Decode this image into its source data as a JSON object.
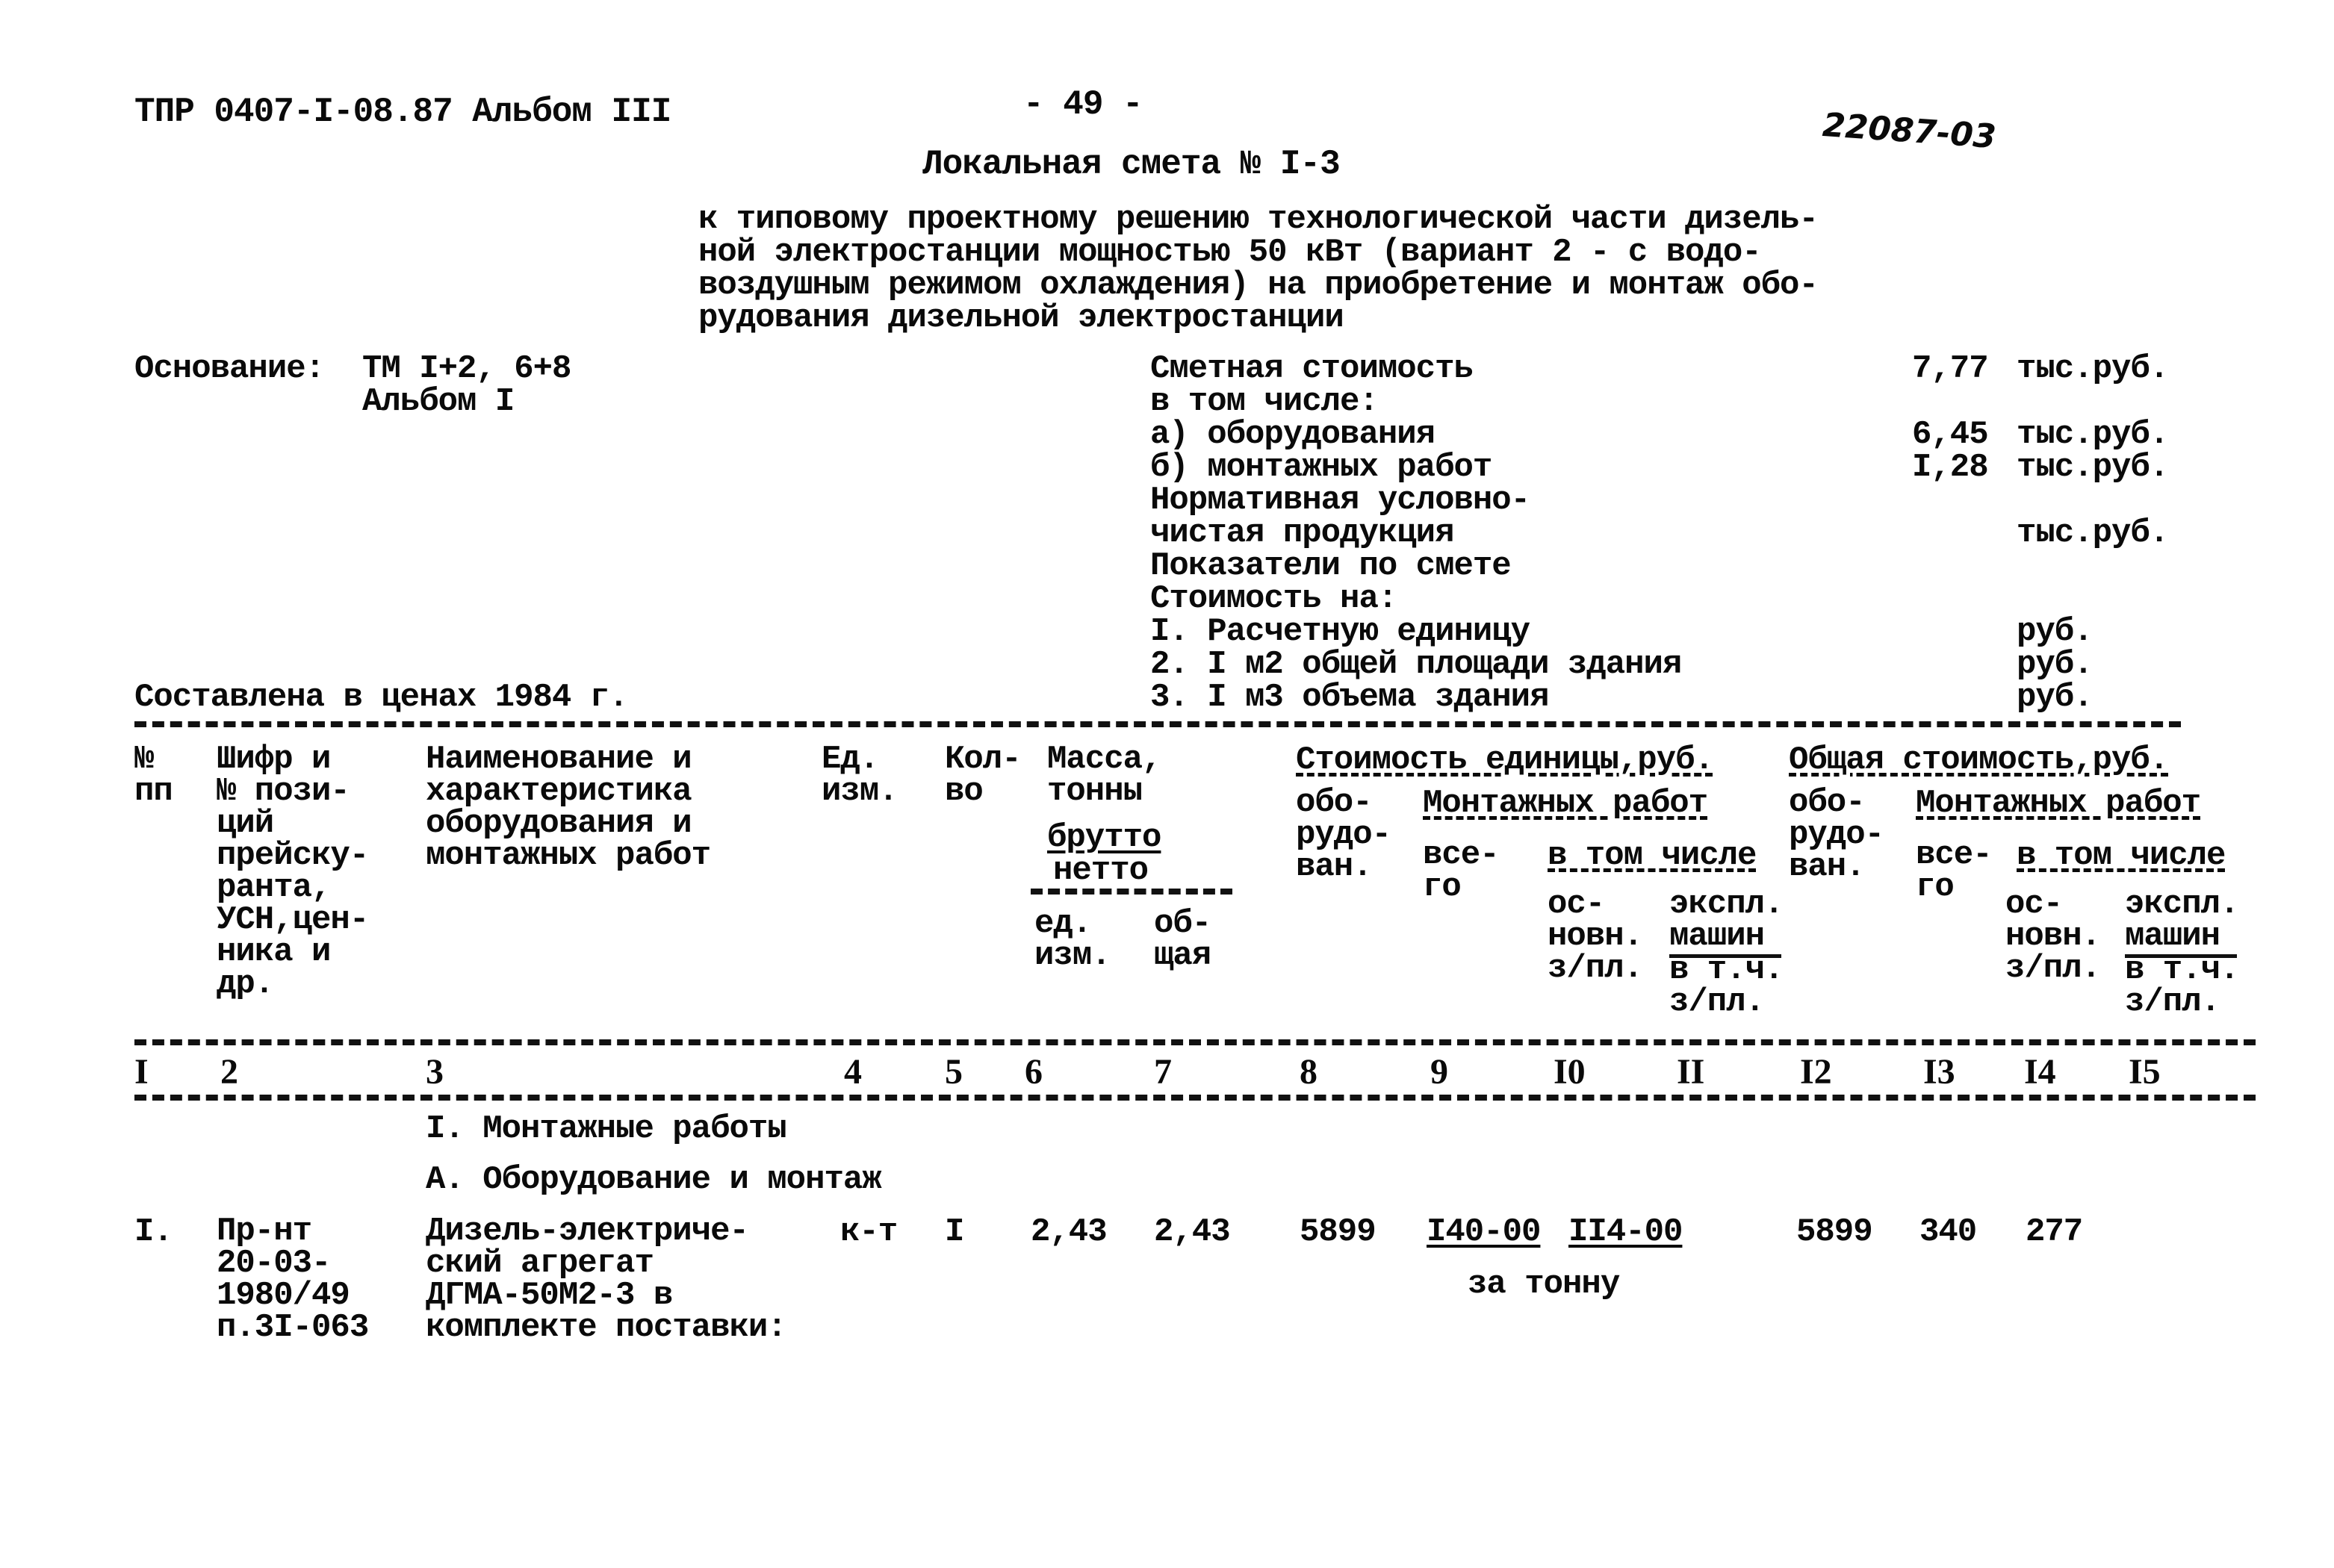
{
  "header": {
    "doc_code": "ТПР 0407-I-08.87 Альбом III",
    "page_number": "- 49 -",
    "stamp": "22087-03",
    "title": "Локальная смета № I-3",
    "subtitle_lines": [
      "к типовому проектному решению технологической части дизель-",
      "ной электростанции мощностью 50 кВт (вариант 2 - с водо-",
      "воздушным режимом охлаждения) на приобретение и монтаж обо-",
      "рудования дизельной электростанции"
    ]
  },
  "basis": {
    "label": "Основание:",
    "line1": "ТМ I+2, 6+8",
    "line2": "Альбом I"
  },
  "summary": {
    "rows": [
      {
        "label": "Сметная стоимость",
        "value": "7,77",
        "unit": "тыс.руб."
      },
      {
        "label": "в том числе:",
        "value": "",
        "unit": ""
      },
      {
        "label": "а) оборудования",
        "value": "6,45",
        "unit": "тыс.руб."
      },
      {
        "label": "б) монтажных работ",
        "value": "I,28",
        "unit": "тыс.руб."
      },
      {
        "label": "Нормативная условно-",
        "value": "",
        "unit": ""
      },
      {
        "label": "чистая продукция",
        "value": "",
        "unit": "тыс.руб."
      },
      {
        "label": "Показатели по смете",
        "value": "",
        "unit": ""
      },
      {
        "label": "Стоимость на:",
        "value": "",
        "unit": ""
      },
      {
        "label": "I. Расчетную единицу",
        "value": "",
        "unit": "руб."
      },
      {
        "label": "2. I м2 общей площади здания",
        "value": "",
        "unit": "руб."
      },
      {
        "label": "3. I м3 объема здания",
        "value": "",
        "unit": "руб."
      }
    ]
  },
  "prices_note": "Составлена в ценах 1984 г.",
  "table": {
    "headers": {
      "c1": [
        "№",
        "пп"
      ],
      "c2": [
        "Шифр и",
        "№ пози-",
        "ций",
        "прейску-",
        "ранта,",
        "УСН,цен-",
        "ника и",
        "др."
      ],
      "c3": [
        "Наименование и",
        "характеристика",
        "оборудования и",
        "монтажных работ"
      ],
      "c4": [
        "Ед.",
        "изм."
      ],
      "c5": [
        "Кол-",
        "во"
      ],
      "mass": [
        "Масса,",
        "тонны"
      ],
      "mass_frac_top": "брутто",
      "mass_frac_bottom": "нетто",
      "c6": [
        "ед.",
        "изм."
      ],
      "c7": [
        "об-",
        "щая"
      ],
      "unit_cost_group": "Стоимость единицы,руб.",
      "total_cost_group": "Общая стоимость,руб.",
      "equip": [
        "обо-",
        "рудо-",
        "ван."
      ],
      "mont_group": "Монтажных работ",
      "total_all": [
        "все-",
        "го"
      ],
      "incl": "в том числе",
      "basic_wage": [
        "ос-",
        "новн.",
        "з/пл."
      ],
      "machines": [
        "экспл.",
        "машин"
      ],
      "machines_sub": [
        "в т.ч.",
        "з/пл."
      ]
    },
    "column_numbers": [
      "I",
      "2",
      "3",
      "4",
      "5",
      "6",
      "7",
      "8",
      "9",
      "I0",
      "II",
      "I2",
      "I3",
      "I4",
      "I5"
    ],
    "section_title": "I. Монтажные работы",
    "subsection_title": "А. Оборудование и монтаж",
    "rows": [
      {
        "num": "I.",
        "code": [
          "Пр-нт",
          "20-03-",
          "1980/49",
          "п.3I-063"
        ],
        "name": [
          "Дизель-электриче-",
          "ский агрегат",
          "ДГМА-50М2-3 в",
          "комплекте поставки:"
        ],
        "unit": "к-т",
        "qty": "I",
        "mass_unit": "2,43",
        "mass_total": "2,43",
        "unit_equip": "5899",
        "unit_mont_total": "I40-00",
        "unit_mont_basic": "II4-00",
        "unit_mont_note": "за тонну",
        "total_equip": "5899",
        "total_mont": "340",
        "total_basic": "277"
      }
    ]
  }
}
